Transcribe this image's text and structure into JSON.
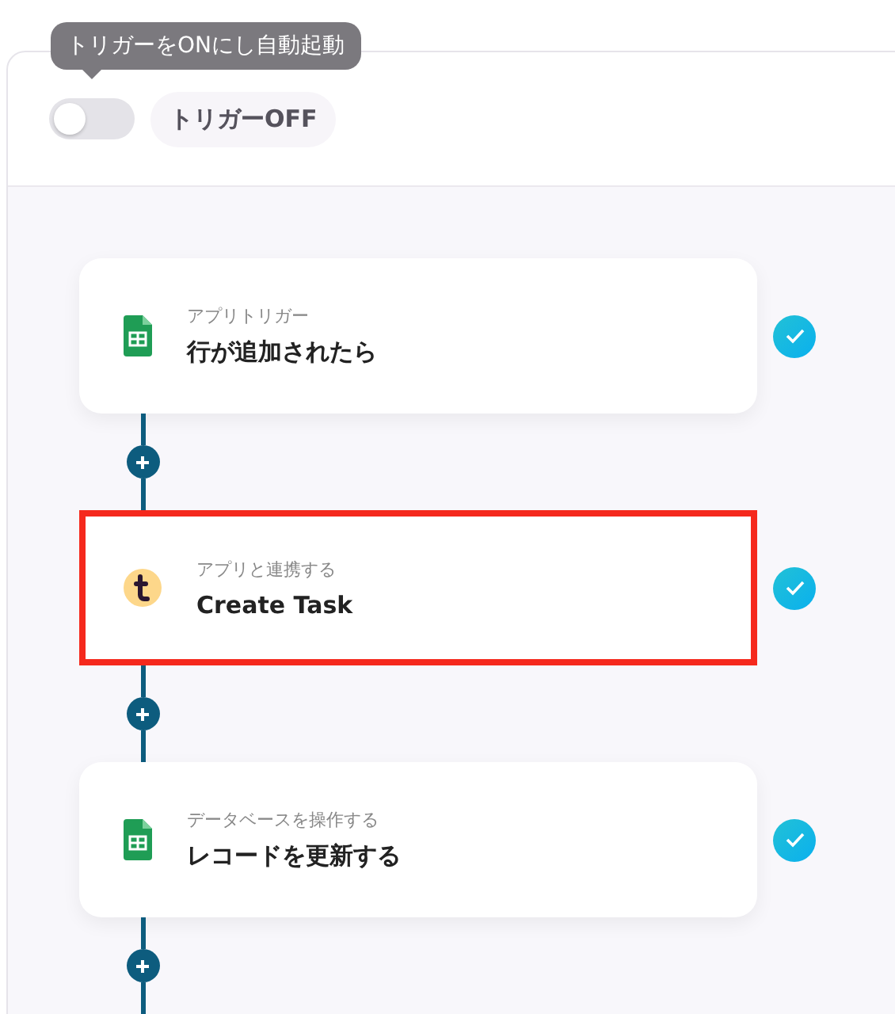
{
  "tooltip": "トリガーをONにし自動起動",
  "trigger": {
    "on": false,
    "label": "トリガーOFF"
  },
  "steps": [
    {
      "kind": "sheets",
      "category": "アプリトリガー",
      "title": "行が追加されたら",
      "highlighted": false,
      "done": true
    },
    {
      "kind": "t-app",
      "category": "アプリと連携する",
      "title": "Create Task",
      "highlighted": true,
      "done": true
    },
    {
      "kind": "sheets",
      "category": "データベースを操作する",
      "title": "レコードを更新する",
      "highlighted": false,
      "done": true
    }
  ]
}
